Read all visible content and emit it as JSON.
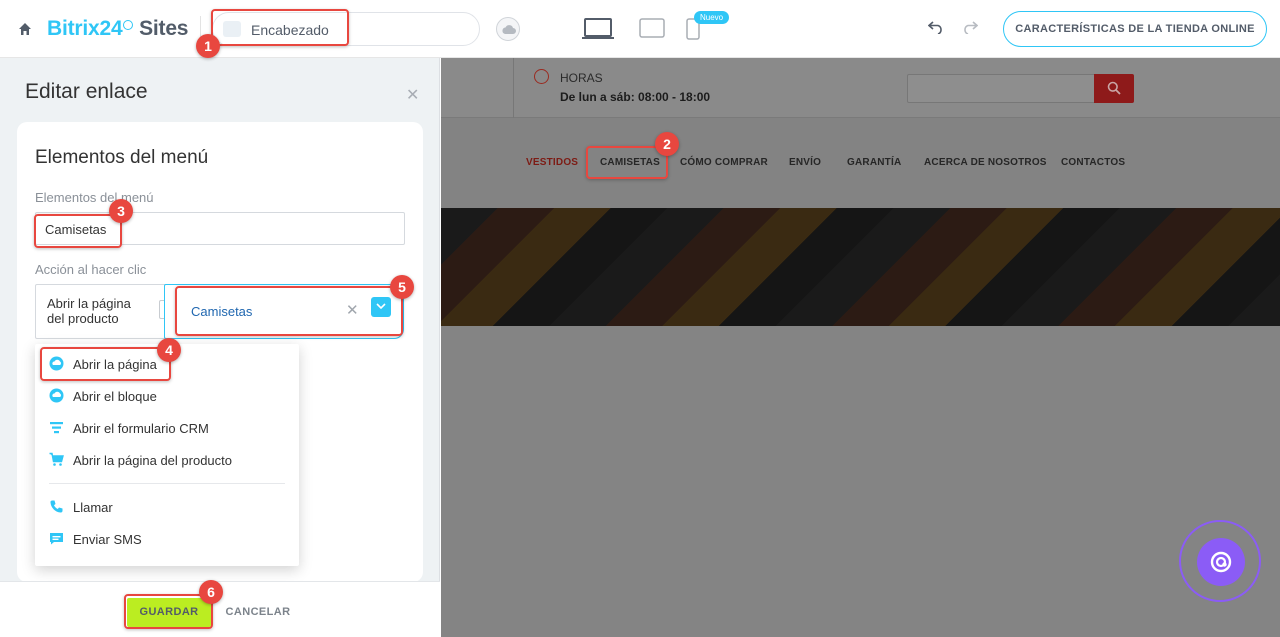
{
  "header": {
    "brand_main": "Bitrix24",
    "brand_sites": "Sites",
    "page_name": "Encabezado",
    "nuevo_badge": "Nuevo",
    "store_button": "CARACTERÍSTICAS DE LA TIENDA ONLINE"
  },
  "panel": {
    "title": "Editar enlace",
    "card_title": "Elementos del menú",
    "name_label": "Elementos del menú",
    "name_value": "Camisetas",
    "action_label": "Acción al hacer clic",
    "action_value": "Abrir la página del producto",
    "target_value": "Camisetas",
    "menu_items": [
      {
        "label": "Abrir la página",
        "icon": "page-icon"
      },
      {
        "label": "Abrir el bloque",
        "icon": "block-icon"
      },
      {
        "label": "Abrir el formulario CRM",
        "icon": "form-icon"
      },
      {
        "label": "Abrir la página del producto",
        "icon": "cart-icon"
      },
      {
        "label": "Llamar",
        "icon": "phone-icon"
      },
      {
        "label": "Enviar SMS",
        "icon": "sms-icon"
      }
    ],
    "save_label": "GUARDAR",
    "cancel_label": "CANCELAR"
  },
  "preview": {
    "hours_label": "HORAS",
    "hours_value": "De lun a sáb: 08:00 - 18:00",
    "nav": [
      "VESTIDOS",
      "CAMISETAS",
      "CÓMO COMPRAR",
      "ENVÍO",
      "GARANTÍA",
      "ACERCA DE NOSOTROS",
      "CONTACTOS"
    ]
  },
  "annotations": [
    "1",
    "2",
    "3",
    "4",
    "5",
    "6"
  ],
  "colors": {
    "accent": "#2fc6f6",
    "save": "#bbed21",
    "highlight": "#e8473f",
    "fab": "#8b5cf6"
  }
}
